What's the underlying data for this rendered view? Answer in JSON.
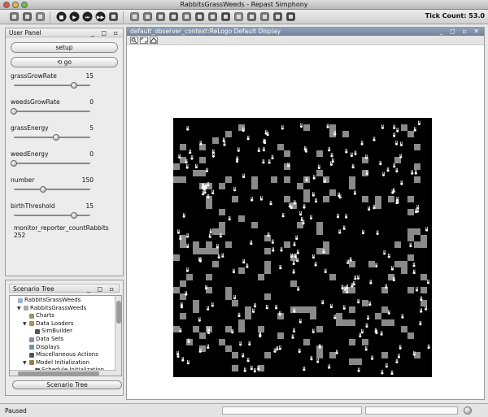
{
  "window": {
    "title": "RabbitsGrassWeeds - Repast Simphony"
  },
  "toolbar": {
    "buttons": [
      "save-icon",
      "database-icon",
      "stack-icon",
      "stop-icon",
      "play-icon",
      "step-icon",
      "run-icon",
      "reset-icon",
      "chart-icon",
      "table-icon",
      "settings-icon",
      "gear-icon",
      "globe-icon",
      "sphere-icon",
      "world-icon",
      "network-icon",
      "map-icon",
      "grid-icon",
      "calculator-icon",
      "tool-icon",
      "truck-icon"
    ],
    "tick_label": "Tick Count:",
    "tick_value": "53.0"
  },
  "user_panel": {
    "title": "User Panel",
    "setup_label": "setup",
    "go_label": "go",
    "sliders": [
      {
        "label": "grassGrowRate",
        "value": "15",
        "fraction": 0.79
      },
      {
        "label": "weedsGrowRate",
        "value": "0",
        "fraction": 0.0
      },
      {
        "label": "grassEnergy",
        "value": "5",
        "fraction": 0.55
      },
      {
        "label": "weedEnergy",
        "value": "0",
        "fraction": 0.0
      },
      {
        "label": "number",
        "value": "150",
        "fraction": 0.38
      },
      {
        "label": "birthThreshold",
        "value": "15",
        "fraction": 0.79
      }
    ],
    "monitor_label": "monitor_reporter_countRabbits",
    "monitor_value": "252"
  },
  "scenario_tree": {
    "title": "Scenario Tree",
    "tab_label": "Scenario Tree",
    "items": [
      {
        "label": "RabbitsGrassWeeds",
        "depth": 0,
        "arrow": "",
        "icon": "folder-icon"
      },
      {
        "label": "RabbitsGrassWeeds",
        "depth": 1,
        "arrow": "▼",
        "icon": "context-icon"
      },
      {
        "label": "Charts",
        "depth": 2,
        "arrow": "",
        "icon": "chart-icon"
      },
      {
        "label": "Data Loaders",
        "depth": 2,
        "arrow": "▼",
        "icon": "loader-icon"
      },
      {
        "label": "SimBuilder",
        "depth": 3,
        "arrow": "",
        "icon": "gear-icon"
      },
      {
        "label": "Data Sets",
        "depth": 2,
        "arrow": "",
        "icon": "dataset-icon"
      },
      {
        "label": "Displays",
        "depth": 2,
        "arrow": "",
        "icon": "display-icon"
      },
      {
        "label": "Miscellaneous Actions",
        "depth": 2,
        "arrow": "",
        "icon": "action-icon"
      },
      {
        "label": "Model Initialization",
        "depth": 2,
        "arrow": "▼",
        "icon": "init-icon"
      },
      {
        "label": "Schedule Initialization",
        "depth": 3,
        "arrow": "",
        "icon": "schedule-icon"
      }
    ]
  },
  "display": {
    "title": "default_observer_context:ReLogo Default Display",
    "tools": [
      "zoom-icon",
      "fit-icon",
      "home-icon"
    ],
    "colors": {
      "background": "#000000",
      "grass": "#8a8a8a",
      "rabbit": "#ffffff"
    }
  },
  "status": {
    "text": "Paused"
  }
}
